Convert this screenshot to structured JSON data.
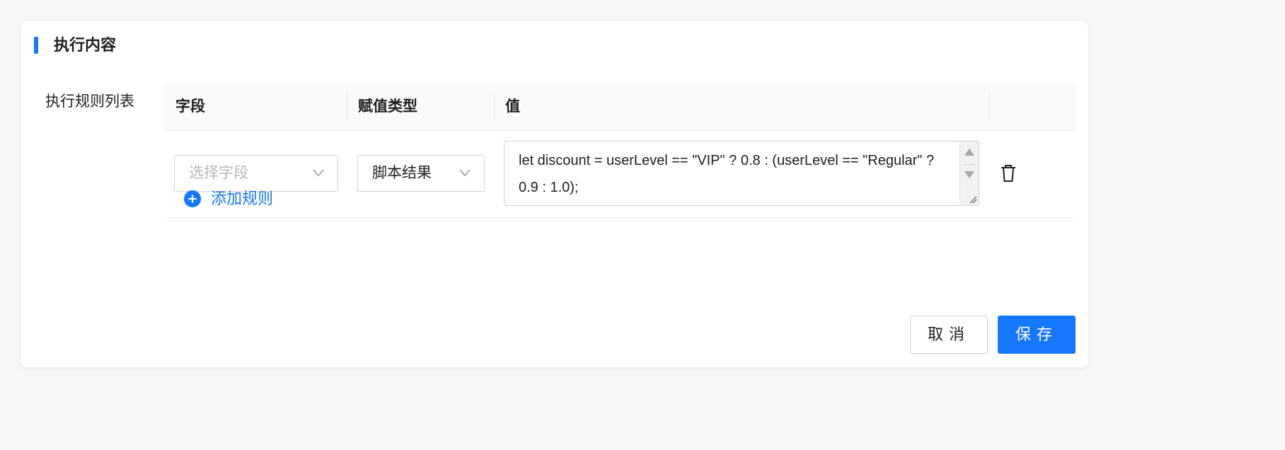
{
  "section": {
    "title": "执行内容"
  },
  "form": {
    "label": "执行规则列表"
  },
  "table": {
    "columns": [
      "字段",
      "赋值类型",
      "值",
      ""
    ],
    "rows": [
      {
        "field_placeholder": "选择字段",
        "assign_type": "脚本结果",
        "value": "let discount = userLevel == \"VIP\" ? 0.8 : (userLevel == \"Regular\" ? 0.9 : 1.0);"
      }
    ]
  },
  "add_rule_label": "添加规则",
  "actions": {
    "cancel_label": "取消",
    "save_label": "保存"
  },
  "colors": {
    "accent": "#1677ff",
    "text": "#1f1f1f",
    "placeholder": "#b8b8b8",
    "border": "#d4d4d4"
  },
  "icons": {
    "chevron": "chevron-down-icon",
    "delete": "trash-icon",
    "add": "plus-circle-icon"
  }
}
